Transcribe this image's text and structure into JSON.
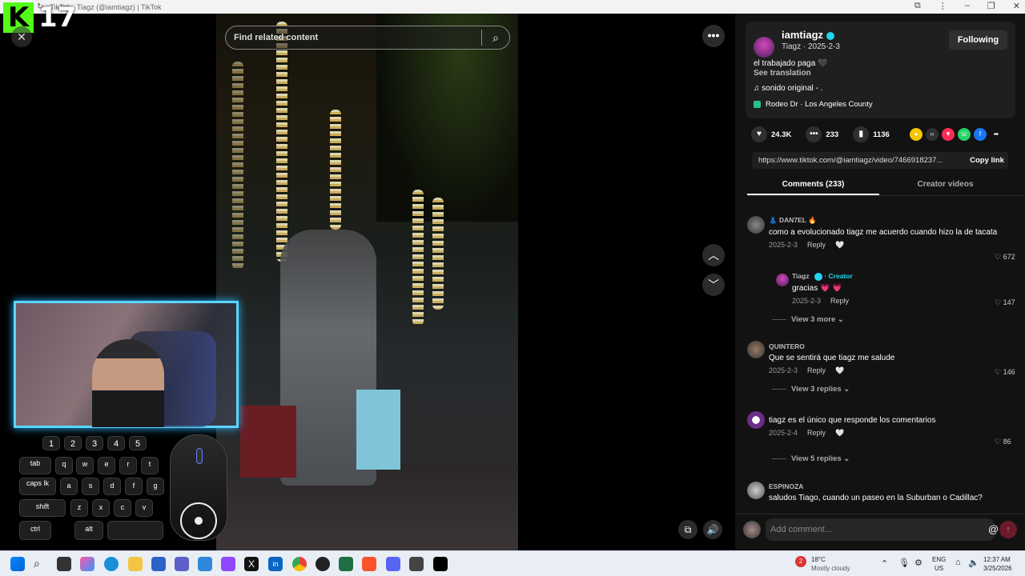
{
  "window": {
    "title": "TikTok - Tiagz (@iamtiagz) | TikTok"
  },
  "overlay": {
    "brand_letter": "K",
    "brand_number": "17"
  },
  "video": {
    "search_placeholder": "Find related content"
  },
  "keyboard": {
    "row1": [
      "1",
      "2",
      "3",
      "4",
      "5"
    ],
    "row2": [
      "tab",
      "q",
      "w",
      "e",
      "r",
      "t"
    ],
    "row3": [
      "caps lk",
      "a",
      "s",
      "d",
      "f",
      "g"
    ],
    "row4": [
      "shift",
      "z",
      "x",
      "c",
      "v"
    ],
    "row5": [
      "ctrl",
      "alt"
    ]
  },
  "post": {
    "username": "iamtiagz",
    "subline": "Tiagz · 2025-2-3",
    "follow_label": "Following",
    "description": "el trabajado paga 🖤",
    "see_translation": "See translation",
    "sound": "♫  sonido original - .",
    "location": "Rodeo Dr · Los Angeles County",
    "likes": "24.3K",
    "comments_count": "233",
    "saves": "1136",
    "link": "https://www.tiktok.com/@iamtiagz/video/7466918237...",
    "copy_link": "Copy link",
    "tab_comments": "Comments (233)",
    "tab_creator": "Creator videos"
  },
  "comments": [
    {
      "name": "👗 DAN7EL 🔥",
      "text": "como a evolucionado tiagz me acuerdo cuando hizo la de tacata",
      "date": "2025-2-3",
      "reply": "Reply",
      "likes": "672"
    },
    {
      "name": "Tiagz",
      "creator_label": "· Creator",
      "text": "gracias 💗 💗",
      "date": "2025-2-3",
      "reply": "Reply",
      "likes": "147"
    },
    {
      "name": "QUINTERO",
      "text": "Que se sentirá que tiagz me salude",
      "date": "2025-2-3",
      "reply": "Reply",
      "likes": "146"
    },
    {
      "name": "",
      "text": "tiagz es el único que responde los comentarios",
      "date": "2025-2-4",
      "reply": "Reply",
      "likes": "86"
    },
    {
      "name": "ESPINOZA",
      "text": "saludos Tiago, cuando un paseo en la Suburban o Cadillac?"
    }
  ],
  "view_more": [
    "View 3 more",
    "View 3 replies",
    "View 5 replies"
  ],
  "add_comment_placeholder": "Add comment...",
  "taskbar": {
    "weather_temp": "18°C",
    "weather_desc": "Mostly cloudy",
    "lang": "ENG",
    "region": "US",
    "time": "12:37 AM",
    "date": "3/25/2026",
    "notif_count": "2"
  }
}
